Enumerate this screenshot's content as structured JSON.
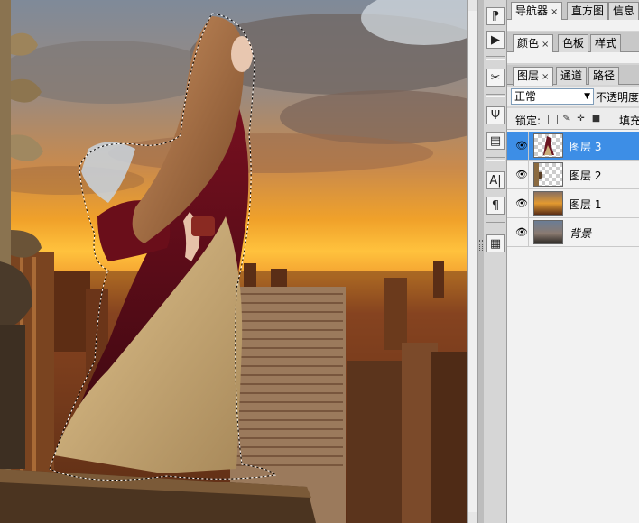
{
  "panel_tabs_row1": [
    {
      "label": "导航器",
      "close": "×",
      "active": true
    },
    {
      "label": "直方图",
      "active": false
    },
    {
      "label": "信息",
      "active": false
    }
  ],
  "panel_tabs_row2": [
    {
      "label": "颜色",
      "close": "×",
      "active": true
    },
    {
      "label": "色板",
      "active": false
    },
    {
      "label": "样式",
      "active": false
    }
  ],
  "panel_tabs_row3": [
    {
      "label": "图层",
      "close": "×",
      "active": true
    },
    {
      "label": "通道",
      "active": false
    },
    {
      "label": "路径",
      "active": false
    }
  ],
  "layers_panel": {
    "blend_mode": "正常",
    "opacity_label": "不透明度",
    "lock_label": "锁定:",
    "fill_label": "填充",
    "layers": [
      {
        "name": "图层 3",
        "visible": true,
        "selected": true,
        "italic": false
      },
      {
        "name": "图层 2",
        "visible": true,
        "selected": false,
        "italic": false
      },
      {
        "name": "图层 1",
        "visible": true,
        "selected": false,
        "italic": false
      },
      {
        "name": "背景",
        "visible": true,
        "selected": false,
        "italic": true
      }
    ]
  },
  "tool_dock": {
    "icons": [
      "history-icon",
      "actions-icon",
      "tool-presets-icon",
      "brushes-icon",
      "clone-source-icon",
      "character-icon",
      "paragraph-icon",
      "layer-comps-icon"
    ],
    "glyphs": [
      "⁋",
      "▶",
      "✂",
      "Ψ",
      "▤",
      "A|",
      "¶",
      "▦"
    ]
  },
  "colors": {
    "selected_layer": "#3d8ee6",
    "panel_bg": "#f2f2f2"
  }
}
